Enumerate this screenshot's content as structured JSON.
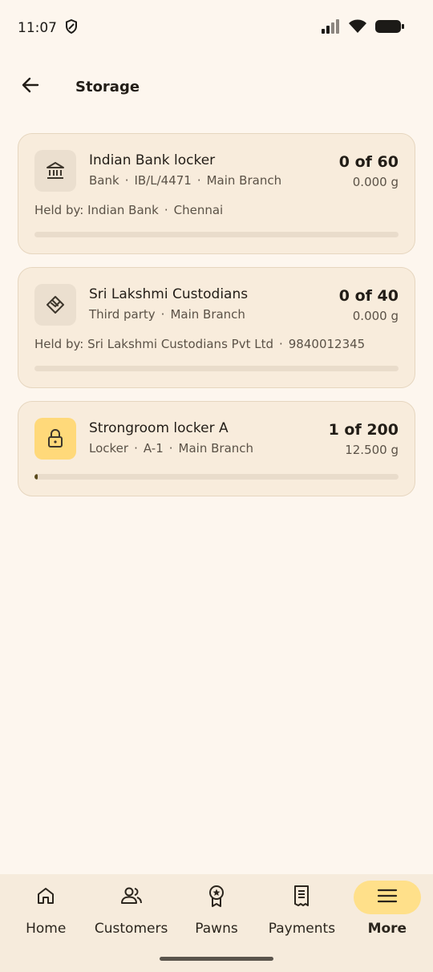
{
  "status": {
    "time": "11:07"
  },
  "header": {
    "title": "Storage"
  },
  "cards": [
    {
      "name": "Indian Bank locker",
      "icon": "bank-icon",
      "meta": [
        "Bank",
        "IB/L/4471",
        "Main Branch"
      ],
      "count": "0 of 60",
      "weight": "0.000 g",
      "held_by": [
        "Held by: Indian Bank",
        "Chennai"
      ],
      "fill": 0
    },
    {
      "name": "Sri Lakshmi Custodians",
      "icon": "handshake-icon",
      "meta": [
        "Third party",
        "Main Branch"
      ],
      "count": "0 of 40",
      "weight": "0.000 g",
      "held_by": [
        "Held by: Sri Lakshmi Custodians Pvt Ltd",
        "9840012345"
      ],
      "fill": 0
    },
    {
      "name": "Strongroom locker A",
      "icon": "lock-icon",
      "meta": [
        "Locker",
        "A-1",
        "Main Branch"
      ],
      "count": "1 of 200",
      "weight": "12.500 g",
      "held_by": [],
      "fill": 0.005
    }
  ],
  "nav": [
    {
      "label": "Home",
      "icon": "home-icon"
    },
    {
      "label": "Customers",
      "icon": "customers-icon"
    },
    {
      "label": "Pawns",
      "icon": "pawns-icon"
    },
    {
      "label": "Payments",
      "icon": "payments-icon"
    },
    {
      "label": "More",
      "icon": "menu-icon",
      "selected": true
    }
  ],
  "colors": {
    "background": "#fdf6ee",
    "card": "#f8ecdc",
    "accent": "#ffd97a",
    "progress": "#5a4a1c"
  }
}
